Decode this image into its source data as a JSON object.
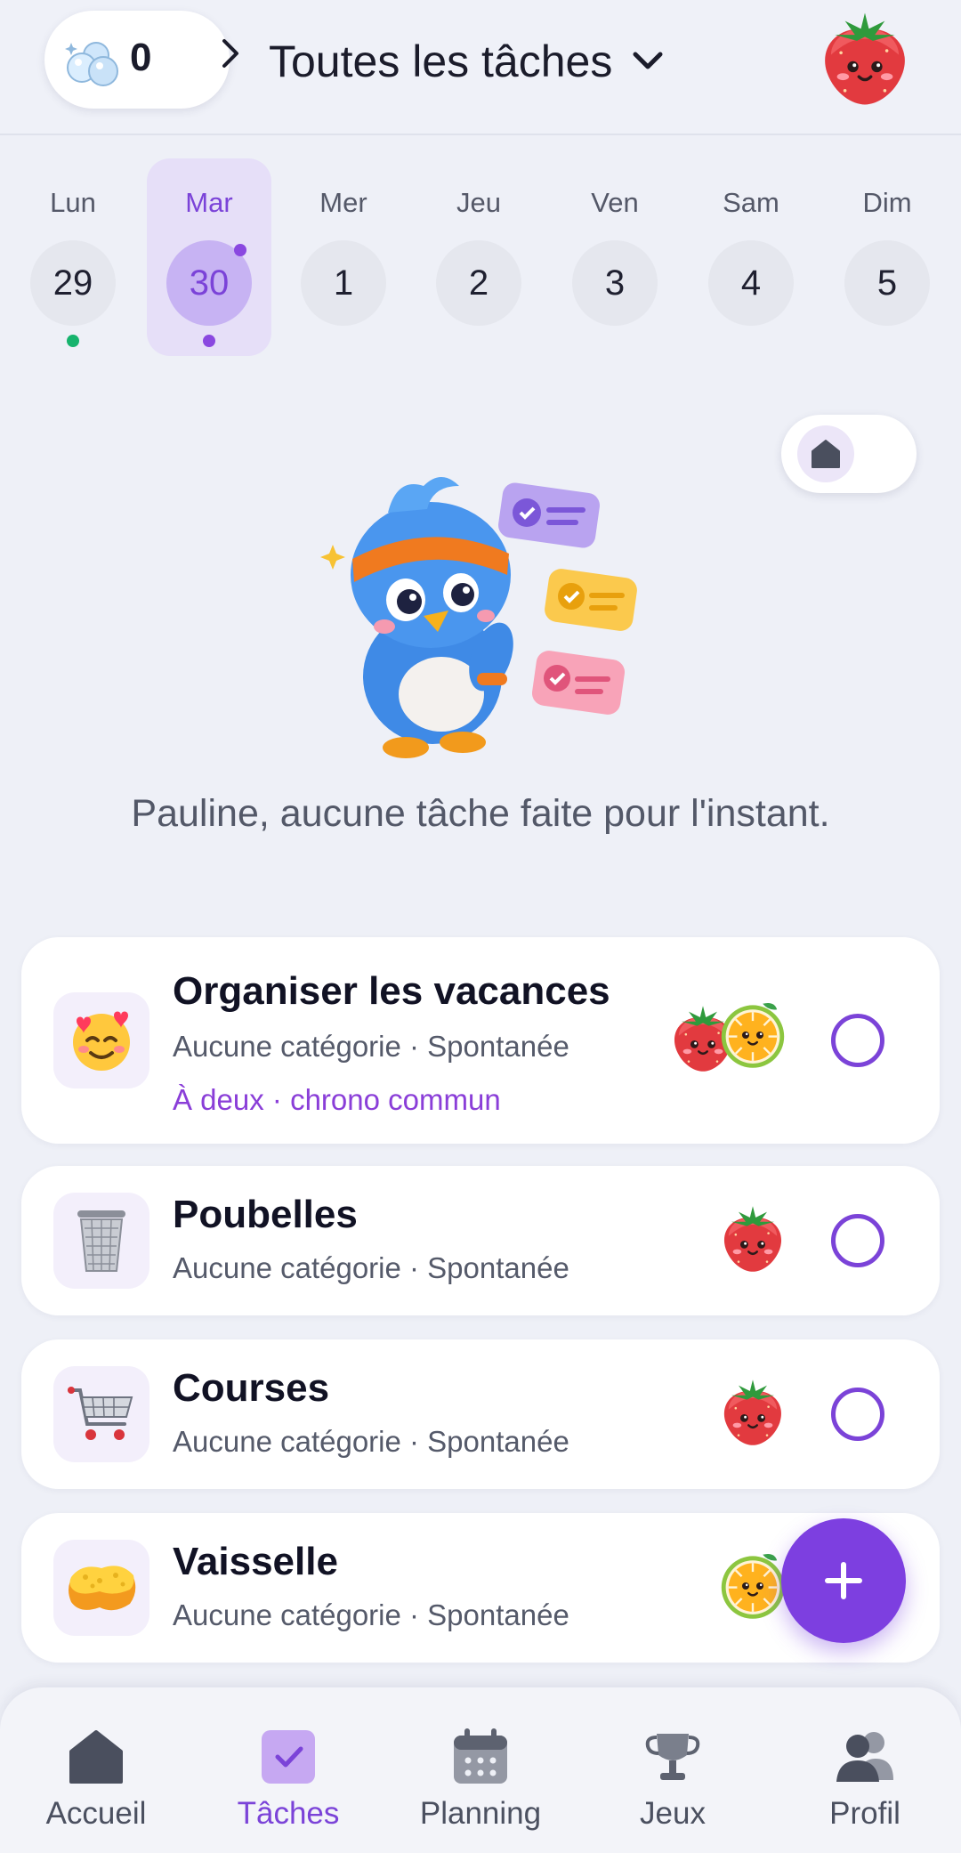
{
  "header": {
    "bubble_count": "0",
    "filter_label": "Toutes les tâches",
    "icons": {
      "bubbles": "bubbles-icon",
      "chevron": "chevron-right-icon",
      "dropdown": "chevron-down-icon",
      "avatar": "strawberry-avatar"
    }
  },
  "week": {
    "days": [
      {
        "label": "Lun",
        "date": "29",
        "selected": false,
        "dot": "green"
      },
      {
        "label": "Mar",
        "date": "30",
        "selected": true,
        "dot": "purple"
      },
      {
        "label": "Mer",
        "date": "1",
        "selected": false,
        "dot": ""
      },
      {
        "label": "Jeu",
        "date": "2",
        "selected": false,
        "dot": ""
      },
      {
        "label": "Ven",
        "date": "3",
        "selected": false,
        "dot": ""
      },
      {
        "label": "Sam",
        "date": "4",
        "selected": false,
        "dot": ""
      },
      {
        "label": "Dim",
        "date": "5",
        "selected": false,
        "dot": ""
      }
    ]
  },
  "empty_state": {
    "message": "Pauline, aucune tâche faite pour l'instant."
  },
  "tasks": [
    {
      "title": "Organiser les vacances",
      "meta": "Aucune catégorie · Spontanée",
      "extra": "À deux · chrono commun",
      "icon": "smiling-face-with-hearts-icon",
      "assignees": [
        "strawberry",
        "orange"
      ]
    },
    {
      "title": "Poubelles",
      "meta": "Aucune catégorie · Spontanée",
      "icon": "trash-can-icon",
      "assignees": [
        "strawberry"
      ]
    },
    {
      "title": "Courses",
      "meta": "Aucune catégorie · Spontanée",
      "icon": "shopping-cart-icon",
      "assignees": [
        "strawberry"
      ]
    },
    {
      "title": "Vaisselle",
      "meta": "Aucune catégorie · Spontanée",
      "icon": "sponge-icon",
      "assignees": [
        "orange"
      ]
    }
  ],
  "nav": {
    "items": [
      {
        "label": "Accueil",
        "icon": "home-icon",
        "active": false
      },
      {
        "label": "Tâches",
        "icon": "check-icon",
        "active": true
      },
      {
        "label": "Planning",
        "icon": "calendar-icon",
        "active": false
      },
      {
        "label": "Jeux",
        "icon": "trophy-icon",
        "active": false
      },
      {
        "label": "Profil",
        "icon": "users-icon",
        "active": false
      }
    ]
  },
  "colors": {
    "accent": "#7b43d8",
    "background": "#eef0f7",
    "green_dot": "#16b36d"
  }
}
